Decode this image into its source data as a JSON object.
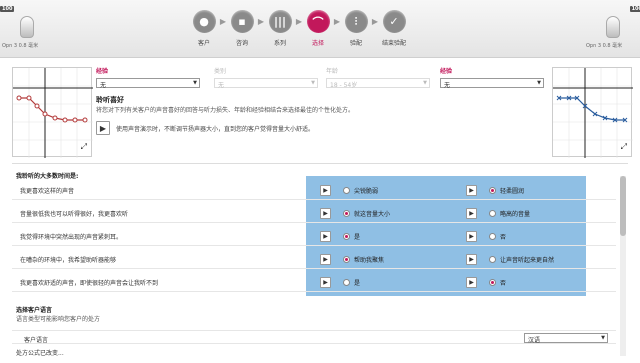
{
  "devices": {
    "left": {
      "number": "100",
      "label": "Opn 3 0.8 毫米"
    },
    "right": {
      "number": "100",
      "label": "Opn 3 0.8 毫米"
    }
  },
  "steps": [
    {
      "label": "客户",
      "icon": "person-icon",
      "glyph": "●"
    },
    {
      "label": "咨询",
      "icon": "chat-icon",
      "glyph": "▪"
    },
    {
      "label": "系列",
      "icon": "series-icon",
      "glyph": "|||"
    },
    {
      "label": "选择",
      "icon": "curve-icon",
      "glyph": "⌒"
    },
    {
      "label": "验配",
      "icon": "sliders-icon",
      "glyph": "⫶"
    },
    {
      "label": "结束验配",
      "icon": "check-icon",
      "glyph": "✓"
    }
  ],
  "filters": [
    {
      "title": "经验",
      "value": "无",
      "disabled": false
    },
    {
      "title": "类别",
      "value": "无",
      "disabled": true
    },
    {
      "title": "年龄",
      "value": "18 - 54岁",
      "disabled": true
    },
    {
      "title": "经验",
      "value": "无",
      "disabled": false
    }
  ],
  "preference": {
    "title": "聆听喜好",
    "description": "将您对下列有关客户的声音喜好的回答与听力损失、年龄和经验相结合来选择最佳的个性化处方。",
    "play_text": "使用声音演示时，不断调节扬声器大小，直到您的客户觉得音量大小舒适。"
  },
  "questions_title": "我聆听的大多数时间是:",
  "questions": [
    {
      "q": "我更喜欢这样的声音",
      "a": "尖锐脆弱",
      "b": "轻柔圆润",
      "selected": "b"
    },
    {
      "q": "音量很低我也可以听得很好，我更喜欢听",
      "a": "就这音量大小",
      "b": "略高的音量",
      "selected": "a"
    },
    {
      "q": "我觉得环境中突然出现的声音紧刺耳。",
      "a": "是",
      "b": "否",
      "selected": "a"
    },
    {
      "q": "在嘈杂的环境中，我希望助听器能够",
      "a": "帮助我聚焦",
      "b": "让声音听起来更自然",
      "selected": "a"
    },
    {
      "q": "我更喜欢舒适的声音，即使很轻的声音会让我听不到",
      "a": "是",
      "b": "否",
      "selected": "b"
    }
  ],
  "language": {
    "title": "选择客户语言",
    "description": "语言类型可能影响您客户的处方",
    "label": "客户语言",
    "value": "汉语"
  },
  "formula_text": "处方公式已改变..."
}
